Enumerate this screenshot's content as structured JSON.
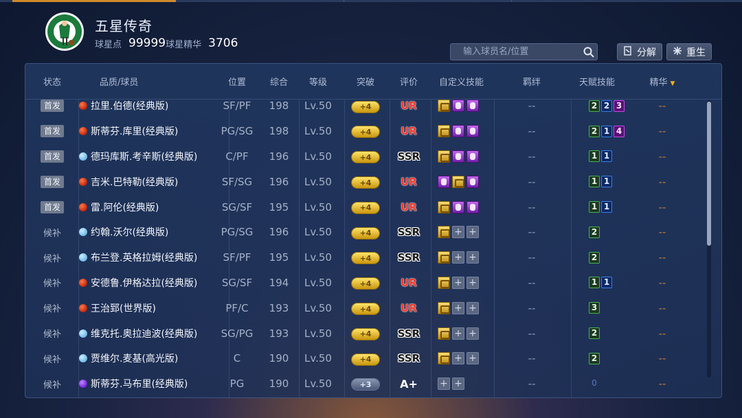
{
  "team": {
    "name": "五星传奇",
    "logo_text": "BOSTON CELTICS",
    "points_label": "球星点",
    "points_value": "99999",
    "essence_label": "球星精华",
    "essence_value": "3706"
  },
  "search": {
    "placeholder": "输入球员名/位置"
  },
  "actions": {
    "dismantle_label": "分解",
    "reborn_label": "重生"
  },
  "table": {
    "headers": {
      "status": "状态",
      "player": "品质/球员",
      "position": "位置",
      "overall": "综合",
      "level": "等级",
      "breakthrough": "突破",
      "rating": "评价",
      "custom_skills": "自定义技能",
      "bond": "羁绊",
      "talent": "天赋技能",
      "essence": "精华"
    },
    "rows": [
      {
        "status": "首发",
        "quality": "red",
        "name": "拉里.伯德(经典版)",
        "position": "SF/PF",
        "overall": "198",
        "level": "Lv.50",
        "breakthrough": "+4",
        "rating": "UR",
        "skills": [
          "gold",
          "purple",
          "purple"
        ],
        "bond": "--",
        "talents": [
          {
            "v": "2",
            "c": "green"
          },
          {
            "v": "2",
            "c": "blue"
          },
          {
            "v": "3",
            "c": "purple"
          }
        ],
        "essence": "--"
      },
      {
        "status": "首发",
        "quality": "red",
        "name": "斯蒂芬.库里(经典版)",
        "position": "PG/SG",
        "overall": "198",
        "level": "Lv.50",
        "breakthrough": "+4",
        "rating": "UR",
        "skills": [
          "gold",
          "purple",
          "purple"
        ],
        "bond": "--",
        "talents": [
          {
            "v": "2",
            "c": "green"
          },
          {
            "v": "1",
            "c": "blue"
          },
          {
            "v": "4",
            "c": "purple"
          }
        ],
        "essence": "--"
      },
      {
        "status": "首发",
        "quality": "blue",
        "name": "德玛库斯.考辛斯(经典版)",
        "position": "C/PF",
        "overall": "196",
        "level": "Lv.50",
        "breakthrough": "+4",
        "rating": "SSR",
        "skills": [
          "gold",
          "purple",
          "purple"
        ],
        "bond": "--",
        "talents": [
          {
            "v": "1",
            "c": "green"
          },
          {
            "v": "1",
            "c": "blue"
          }
        ],
        "essence": "--"
      },
      {
        "status": "首发",
        "quality": "red",
        "name": "吉米.巴特勒(经典版)",
        "position": "SF/SG",
        "overall": "196",
        "level": "Lv.50",
        "breakthrough": "+4",
        "rating": "UR",
        "skills": [
          "purple",
          "gold",
          "purple"
        ],
        "bond": "--",
        "talents": [
          {
            "v": "1",
            "c": "green"
          },
          {
            "v": "1",
            "c": "blue"
          }
        ],
        "essence": "--"
      },
      {
        "status": "首发",
        "quality": "red",
        "name": "雷.阿伦(经典版)",
        "position": "SG/SF",
        "overall": "195",
        "level": "Lv.50",
        "breakthrough": "+4",
        "rating": "UR",
        "skills": [
          "gold",
          "purple",
          "purple"
        ],
        "bond": "--",
        "talents": [
          {
            "v": "1",
            "c": "green"
          },
          {
            "v": "1",
            "c": "blue"
          }
        ],
        "essence": "--"
      },
      {
        "status": "候补",
        "quality": "blue",
        "name": "约翰.沃尔(经典版)",
        "position": "PG/SG",
        "overall": "196",
        "level": "Lv.50",
        "breakthrough": "+4",
        "rating": "SSR",
        "skills": [
          "gold",
          "empty",
          "empty"
        ],
        "bond": "--",
        "talents": [
          {
            "v": "2",
            "c": "green"
          }
        ],
        "essence": "--"
      },
      {
        "status": "候补",
        "quality": "blue",
        "name": "布兰登.英格拉姆(经典版)",
        "position": "SF/PF",
        "overall": "195",
        "level": "Lv.50",
        "breakthrough": "+4",
        "rating": "SSR",
        "skills": [
          "gold",
          "empty",
          "empty"
        ],
        "bond": "--",
        "talents": [
          {
            "v": "2",
            "c": "green"
          }
        ],
        "essence": "--"
      },
      {
        "status": "候补",
        "quality": "red",
        "name": "安德鲁.伊格达拉(经典版)",
        "position": "SG/SF",
        "overall": "194",
        "level": "Lv.50",
        "breakthrough": "+4",
        "rating": "UR",
        "skills": [
          "gold",
          "empty",
          "empty"
        ],
        "bond": "--",
        "talents": [
          {
            "v": "1",
            "c": "green"
          },
          {
            "v": "1",
            "c": "blue"
          }
        ],
        "essence": "--"
      },
      {
        "status": "候补",
        "quality": "red",
        "name": "王治郅(世界版)",
        "position": "PF/C",
        "overall": "193",
        "level": "Lv.50",
        "breakthrough": "+4",
        "rating": "UR",
        "skills": [
          "gold",
          "empty",
          "empty"
        ],
        "bond": "--",
        "talents": [
          {
            "v": "3",
            "c": "green"
          }
        ],
        "essence": "--"
      },
      {
        "status": "候补",
        "quality": "blue",
        "name": "维克托.奥拉迪波(经典版)",
        "position": "SG/PG",
        "overall": "193",
        "level": "Lv.50",
        "breakthrough": "+4",
        "rating": "SSR",
        "skills": [
          "gold",
          "empty",
          "empty"
        ],
        "bond": "--",
        "talents": [
          {
            "v": "2",
            "c": "green"
          }
        ],
        "essence": "--"
      },
      {
        "status": "候补",
        "quality": "blue",
        "name": "贾维尔.麦基(高光版)",
        "position": "C",
        "overall": "190",
        "level": "Lv.50",
        "breakthrough": "+4",
        "rating": "SSR",
        "skills": [
          "gold",
          "empty",
          "empty"
        ],
        "bond": "--",
        "talents": [
          {
            "v": "2",
            "c": "green"
          }
        ],
        "essence": "--"
      },
      {
        "status": "候补",
        "quality": "purple",
        "name": "斯蒂芬.马布里(经典版)",
        "position": "PG",
        "overall": "190",
        "level": "Lv.50",
        "breakthrough": "+3",
        "rating": "A+",
        "skills": [
          "empty",
          "empty"
        ],
        "bond": "--",
        "talents": [
          {
            "v": "0",
            "c": "faint"
          }
        ],
        "essence": "--"
      }
    ]
  },
  "colors": {
    "accent_tab": "#d08a2a",
    "ur": "#ff3a2a",
    "talent_green": "#45b252",
    "talent_blue": "#3e7be6",
    "talent_purple": "#c84be8"
  }
}
